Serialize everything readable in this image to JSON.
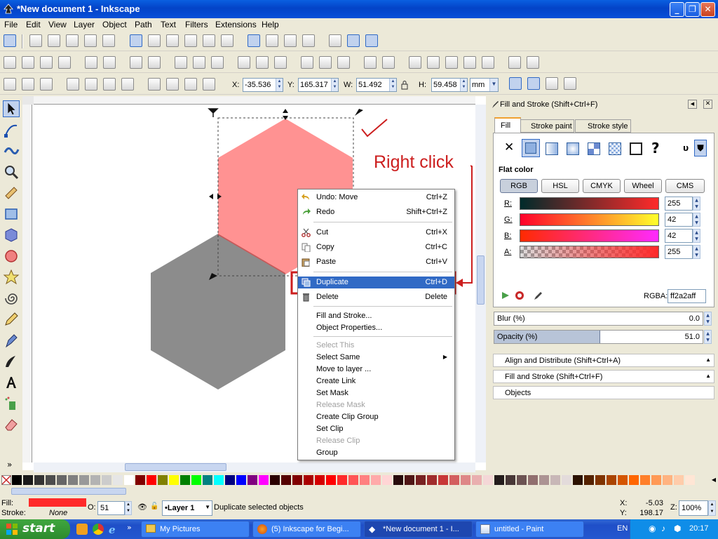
{
  "window": {
    "title": "*New document 1 - Inkscape"
  },
  "menu": [
    "File",
    "Edit",
    "View",
    "Layer",
    "Object",
    "Path",
    "Text",
    "Filters",
    "Extensions",
    "Help"
  ],
  "coords": {
    "x_label": "X:",
    "x": "-35.536",
    "y_label": "Y:",
    "y": "165.317",
    "w_label": "W:",
    "w": "51.492",
    "h_label": "H:",
    "h": "59.458",
    "unit": "mm"
  },
  "annotation": {
    "text": "Right click",
    "color": "#cc1e1e"
  },
  "context_menu": {
    "items": [
      {
        "label": "Undo: Move",
        "accel": "Ctrl+Z"
      },
      {
        "label": "Redo",
        "accel": "Shift+Ctrl+Z"
      },
      {
        "label": "Cut",
        "accel": "Ctrl+X"
      },
      {
        "label": "Copy",
        "accel": "Ctrl+C"
      },
      {
        "label": "Paste",
        "accel": "Ctrl+V"
      },
      {
        "label": "Duplicate",
        "accel": "Ctrl+D"
      },
      {
        "label": "Delete",
        "accel": "Delete"
      },
      {
        "label": "Fill and Stroke..."
      },
      {
        "label": "Object Properties..."
      },
      {
        "label": "Select This"
      },
      {
        "label": "Select Same"
      },
      {
        "label": "Move to layer ..."
      },
      {
        "label": "Create Link"
      },
      {
        "label": "Set Mask"
      },
      {
        "label": "Release Mask"
      },
      {
        "label": "Create Clip Group"
      },
      {
        "label": "Set Clip"
      },
      {
        "label": "Release Clip"
      },
      {
        "label": "Group"
      }
    ],
    "highlight_color": "#316ac5"
  },
  "panel": {
    "title": "Fill and Stroke (Shift+Ctrl+F)",
    "tabs": [
      "Fill",
      "Stroke paint",
      "Stroke style"
    ],
    "flat_color_label": "Flat color",
    "modes": [
      "RGB",
      "HSL",
      "CMYK",
      "Wheel",
      "CMS"
    ],
    "channels": [
      {
        "label": "R:",
        "value": "255"
      },
      {
        "label": "G:",
        "value": "42"
      },
      {
        "label": "B:",
        "value": "42"
      },
      {
        "label": "A:",
        "value": "255"
      }
    ],
    "rgba_label": "RGBA:",
    "rgba": "ff2a2aff",
    "blur_label": "Blur (%)",
    "blur": "0.0",
    "opacity_label": "Opacity (%)",
    "opacity": "51.0",
    "opacity_fraction": 0.51,
    "collapsed": [
      "Align and Distribute (Shift+Ctrl+A)",
      "Fill and Stroke (Shift+Ctrl+F)",
      "Objects"
    ],
    "fill_color": "#ff2a2a"
  },
  "status": {
    "fill_label": "Fill:",
    "stroke_label": "Stroke:",
    "stroke_value": "None",
    "o_label": "O:",
    "o_value": "51",
    "layer": "•Layer 1",
    "message": "Duplicate selected objects",
    "cx_label": "X:",
    "cx": "-5.03",
    "cy_label": "Y:",
    "cy": "198.17",
    "z_label": "Z:",
    "zoom": "100%"
  },
  "taskbar": {
    "start": "start",
    "tasks": [
      "My Pictures",
      "(5) Inkscape for Begi...",
      "*New document 1 - I...",
      "untitled - Paint"
    ],
    "lang": "EN",
    "time": "20:17"
  }
}
